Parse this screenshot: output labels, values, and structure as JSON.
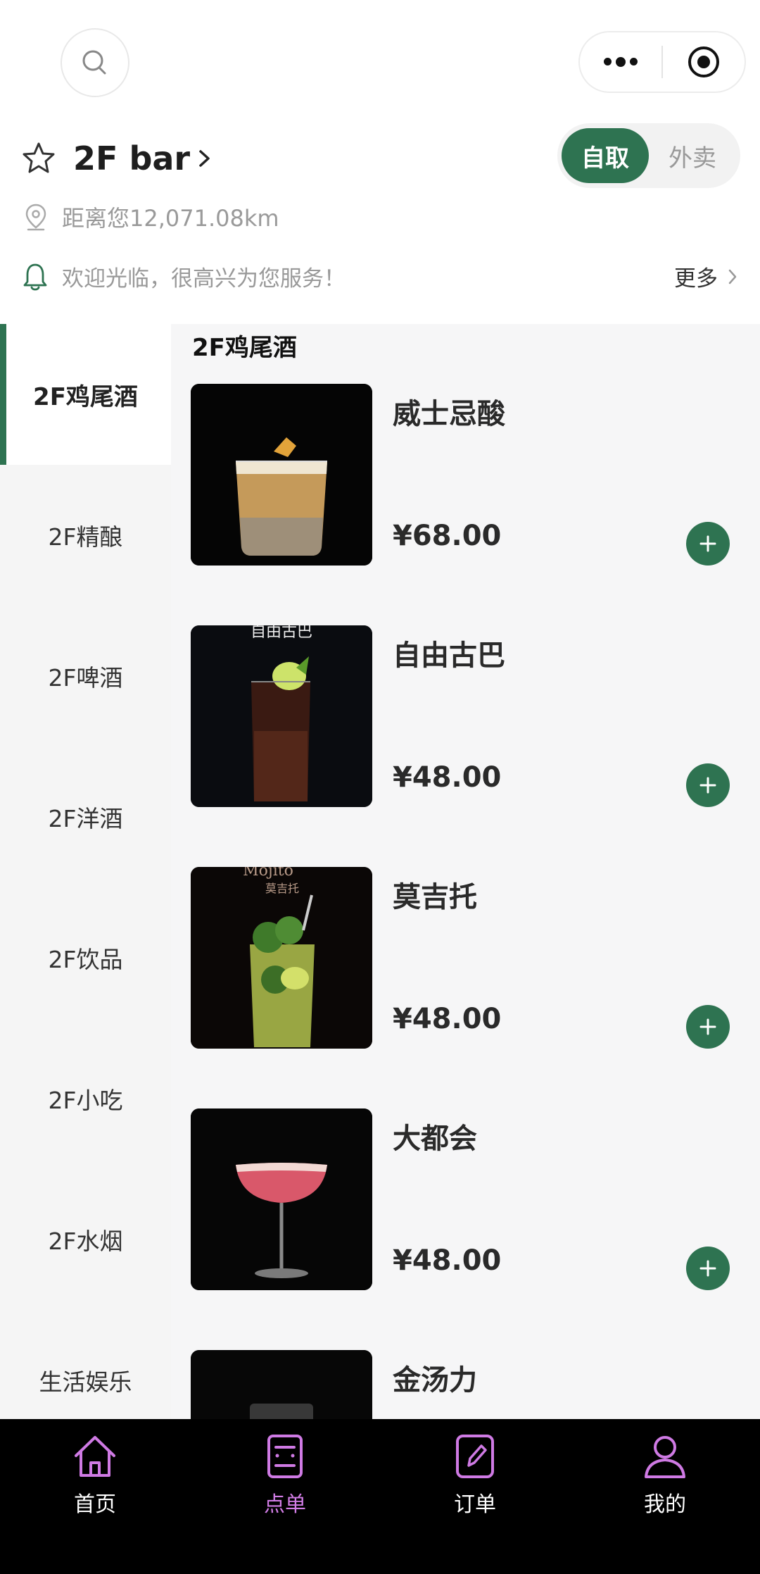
{
  "header": {
    "search_icon": "search-icon",
    "menu_icon": "more-dots-icon",
    "close_icon": "target-circle-icon"
  },
  "store": {
    "name": "2F bar",
    "distance": "距离您12,071.08km",
    "notice": "欢迎光临，很高兴为您服务！",
    "more_label": "更多",
    "modes": {
      "pickup": "自取",
      "delivery": "外卖"
    }
  },
  "sidebar": {
    "categories": [
      {
        "label": "2F鸡尾酒",
        "active": true
      },
      {
        "label": "2F精酿"
      },
      {
        "label": "2F啤酒"
      },
      {
        "label": "2F洋酒"
      },
      {
        "label": "2F饮品"
      },
      {
        "label": "2F小吃"
      },
      {
        "label": "2F水烟"
      },
      {
        "label": "生活娱乐"
      }
    ]
  },
  "menu": {
    "section_title": "2F鸡尾酒",
    "items": [
      {
        "name": "威士忌酸",
        "price": "¥68.00"
      },
      {
        "name": "自由古巴",
        "price": "¥48.00",
        "image_text": "自由古巴"
      },
      {
        "name": "莫吉托",
        "price": "¥48.00",
        "image_text": "Mojito",
        "image_subtext": "莫吉托"
      },
      {
        "name": "大都会",
        "price": "¥48.00"
      },
      {
        "name": "金汤力"
      }
    ]
  },
  "tabbar": {
    "tabs": [
      {
        "label": "首页",
        "icon": "home-icon"
      },
      {
        "label": "点单",
        "icon": "order-menu-icon",
        "active": true
      },
      {
        "label": "订单",
        "icon": "edit-order-icon"
      },
      {
        "label": "我的",
        "icon": "profile-icon"
      }
    ]
  },
  "colors": {
    "accent": "#2e7351",
    "tab_active": "#d27de6",
    "tab_icon": "#cf7ae4"
  }
}
